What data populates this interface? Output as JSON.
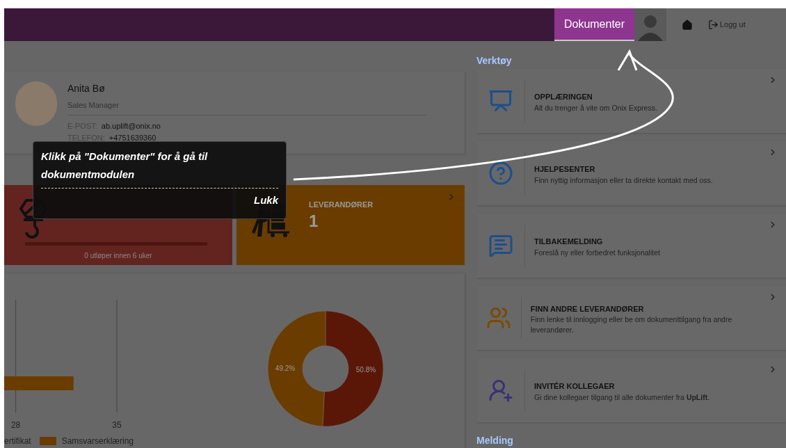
{
  "header": {
    "documents_button": "Dokumenter",
    "logout": "Logg ut"
  },
  "profile": {
    "name": "Anita Bø",
    "role": "Sales Manager",
    "email_label": "E-POST:",
    "email": "ab.uplift@onix.no",
    "phone_label": "TELEFON:",
    "phone": "+4751639360"
  },
  "tiles": [
    {
      "color": "#632420",
      "progress": {
        "level": 0,
        "caption": "0 utløper innen 6 uker"
      }
    },
    {
      "title": "LEVERANDØRER",
      "count": "1",
      "color": "#6a3c00"
    }
  ],
  "bar_chart": {
    "chart_data": {
      "type": "bar",
      "orientation": "horizontal",
      "xlim": [
        27.2,
        35
      ],
      "xticks": [
        28,
        35
      ],
      "series": [
        {
          "name": "ertifikat",
          "values": [
            null
          ]
        },
        {
          "name": "Samsvarserklæring",
          "color": "#6a3c00",
          "values": [
            32
          ]
        }
      ]
    }
  },
  "donut_chart": {
    "chart_data": {
      "type": "donut",
      "values": [
        50.8,
        49.2
      ],
      "value_labels": [
        "50.8%",
        "49.2%"
      ],
      "colors": [
        "#5a1708",
        "#6a3c00"
      ]
    }
  },
  "tools": {
    "heading": "Verktøy",
    "cards": [
      {
        "title": "OPPLÆRINGEN",
        "description": "Alt du trenger å vite om Onix Express."
      },
      {
        "title": "HJELPESENTER",
        "description": "Finn nyttig informasjon eller ta direkte kontakt med oss."
      },
      {
        "title": "TILBAKEMELDING",
        "description": "Foreslå ny eller forbedret funksjonalitet"
      },
      {
        "title": "FINN ANDRE LEVERANDØRER",
        "description": "Finn lenke til innlogging eller be om dokumenttilgang fra andre leverandører."
      },
      {
        "title": "INVITÉR KOLLEGAER",
        "description": "Gi dine kollegaer tilgang til alle dokumenter fra **UpLift**."
      }
    ]
  },
  "messages": {
    "heading": "Melding"
  },
  "tour_tip": {
    "text": "Klikk på \"Dokumenter\" for å gå til dokumentmodulen",
    "close": "Lukk"
  }
}
